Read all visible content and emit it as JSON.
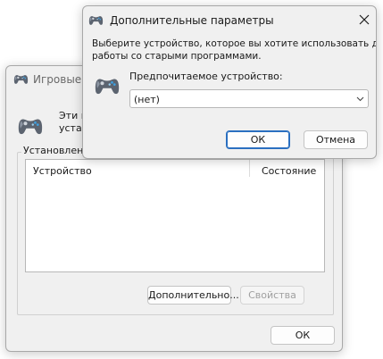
{
  "back_dialog": {
    "title": "Игровые у",
    "description_line1": "Эти п",
    "description_line2": "устан",
    "group_label": "Установленн",
    "columns": [
      "Устройство",
      "Состояние"
    ],
    "advanced_button": "Дополнительно...",
    "properties_button": "Свойства",
    "ok_button": "ОК"
  },
  "front_dialog": {
    "title": "Дополнительные параметры",
    "instruction_line1": "Выберите устройство, которое вы хотите использовать для",
    "instruction_line2": "работы со старыми программами.",
    "preferred_label": "Предпочитаемое устройство:",
    "preferred_value": "(нет)",
    "ok_button": "ОК",
    "cancel_button": "Отмена"
  },
  "icons": {
    "app_icon": "gamepad-icon",
    "close": "close-icon",
    "dropdown": "chevron-down-icon"
  },
  "colors": {
    "default_button_border": "#2a6fc0",
    "window_background": "#f0f0f0"
  }
}
